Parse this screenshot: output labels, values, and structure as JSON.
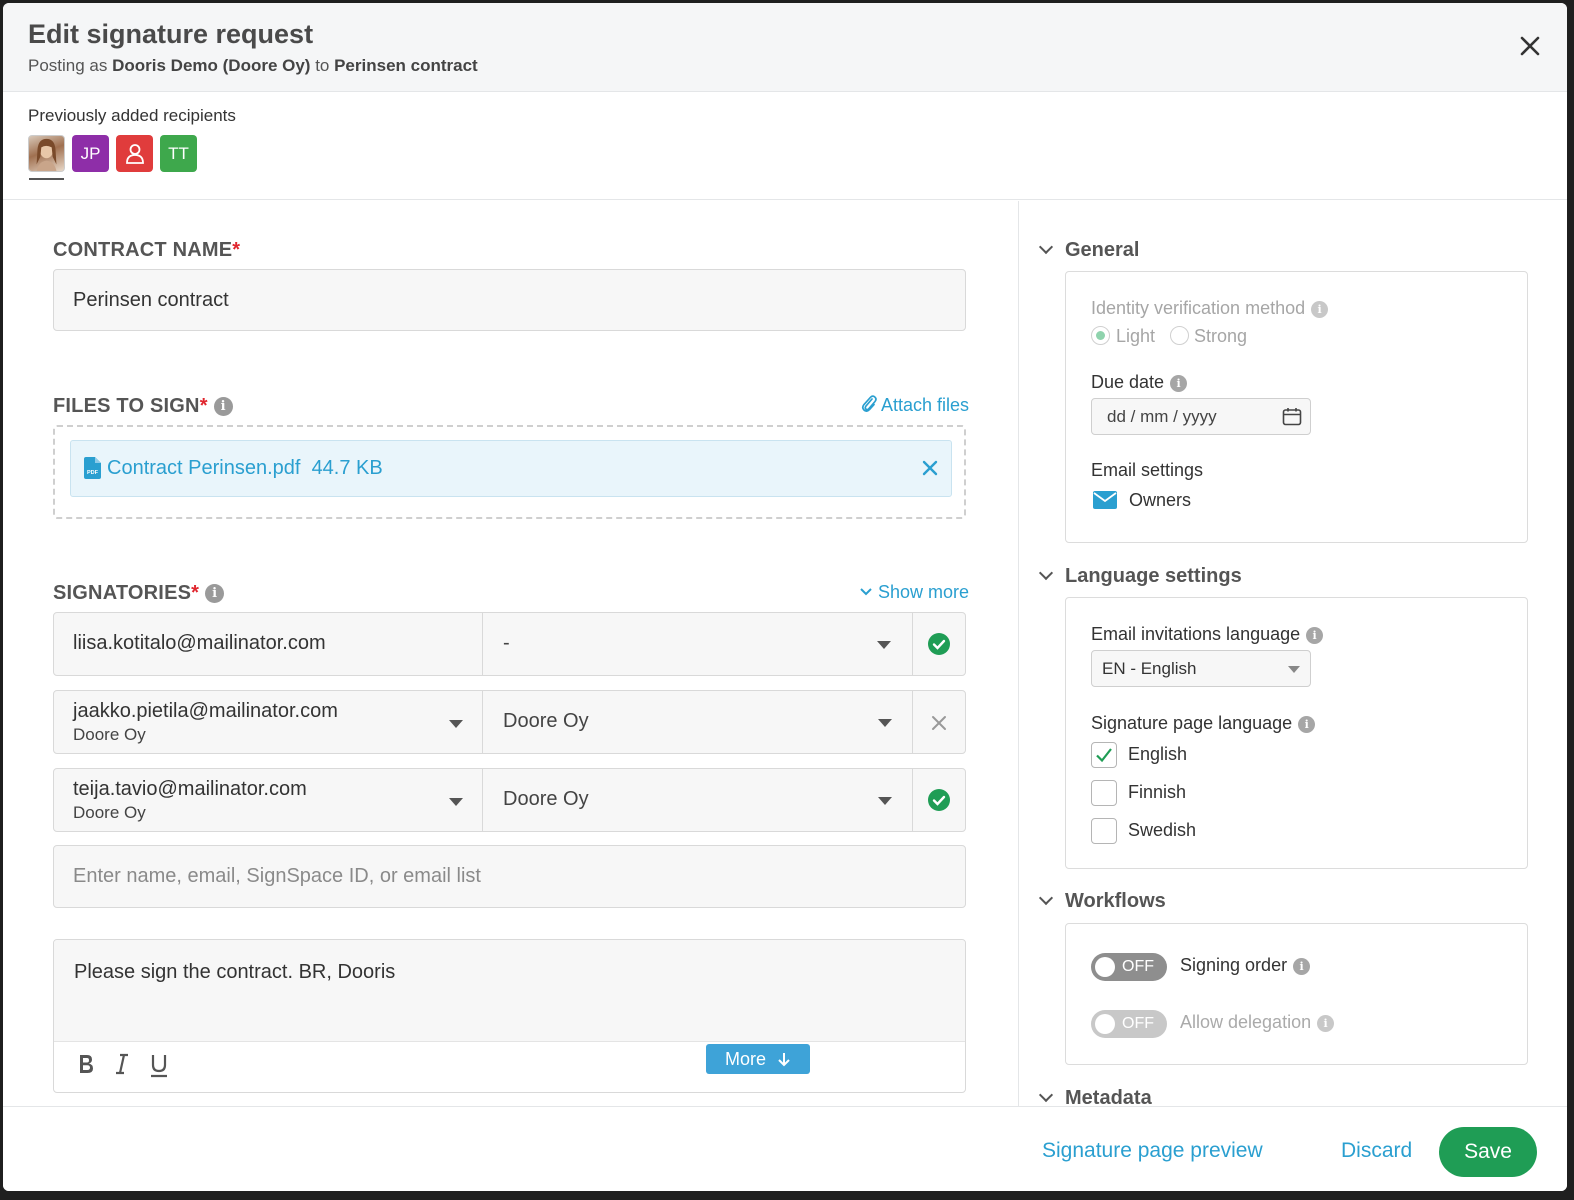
{
  "header": {
    "title": "Edit signature request",
    "posting_prefix": "Posting as ",
    "posting_as": "Dooris Demo (Doore Oy)",
    "posting_to_word": " to ",
    "posting_target": "Perinsen contract"
  },
  "recipients": {
    "label": "Previously added recipients",
    "avatars": [
      {
        "type": "photo"
      },
      {
        "initials": "JP",
        "color": "#8e2ea8"
      },
      {
        "icon": "person-outline-icon",
        "color": "#e03c3c"
      },
      {
        "initials": "TT",
        "color": "#3ea84c"
      }
    ]
  },
  "form": {
    "contract_name_label": "CONTRACT NAME",
    "required_mark": "*",
    "contract_name_value": "Perinsen contract",
    "files_label": "FILES TO SIGN",
    "attach_files": "Attach files",
    "file": {
      "name": "Contract Perinsen.pdf",
      "size": "44.7 KB"
    },
    "signatories_label": "SIGNATORIES",
    "show_more": "Show more",
    "signatories": [
      {
        "email": "liisa.kotitalo@mailinator.com",
        "org": "",
        "org_select": "-",
        "status": "verified"
      },
      {
        "email": "jaakko.pietila@mailinator.com",
        "org": "Doore Oy",
        "org_select": "Doore Oy",
        "status": "remove"
      },
      {
        "email": "teija.tavio@mailinator.com",
        "org": "Doore Oy",
        "org_select": "Doore Oy",
        "status": "verified"
      }
    ],
    "recipient_placeholder": "Enter name, email, SignSpace ID, or email list",
    "message": "Please sign the contract. BR, Dooris",
    "more_button": "More"
  },
  "sidebar": {
    "general": {
      "heading": "General",
      "identity_label": "Identity verification method",
      "identity_options": [
        "Light",
        "Strong"
      ],
      "identity_selected": "Light",
      "due_date_label": "Due date",
      "due_date_placeholder": "dd / mm / yyyy",
      "email_settings_label": "Email settings",
      "email_settings_value": "Owners"
    },
    "language": {
      "heading": "Language settings",
      "email_lang_label": "Email invitations language",
      "email_lang_value": "EN - English",
      "sig_page_lang_label": "Signature page language",
      "sig_page_langs": [
        {
          "label": "English",
          "checked": true
        },
        {
          "label": "Finnish",
          "checked": false
        },
        {
          "label": "Swedish",
          "checked": false
        }
      ]
    },
    "workflows": {
      "heading": "Workflows",
      "signing_order_label": "Signing order",
      "signing_order_state": "OFF",
      "delegation_label": "Allow delegation",
      "delegation_state": "OFF"
    },
    "metadata_heading": "Metadata"
  },
  "footer": {
    "preview": "Signature page preview",
    "discard": "Discard",
    "save": "Save"
  },
  "colors": {
    "accent": "#2a9fd0",
    "success": "#1f9d55",
    "required": "#e0262e"
  }
}
